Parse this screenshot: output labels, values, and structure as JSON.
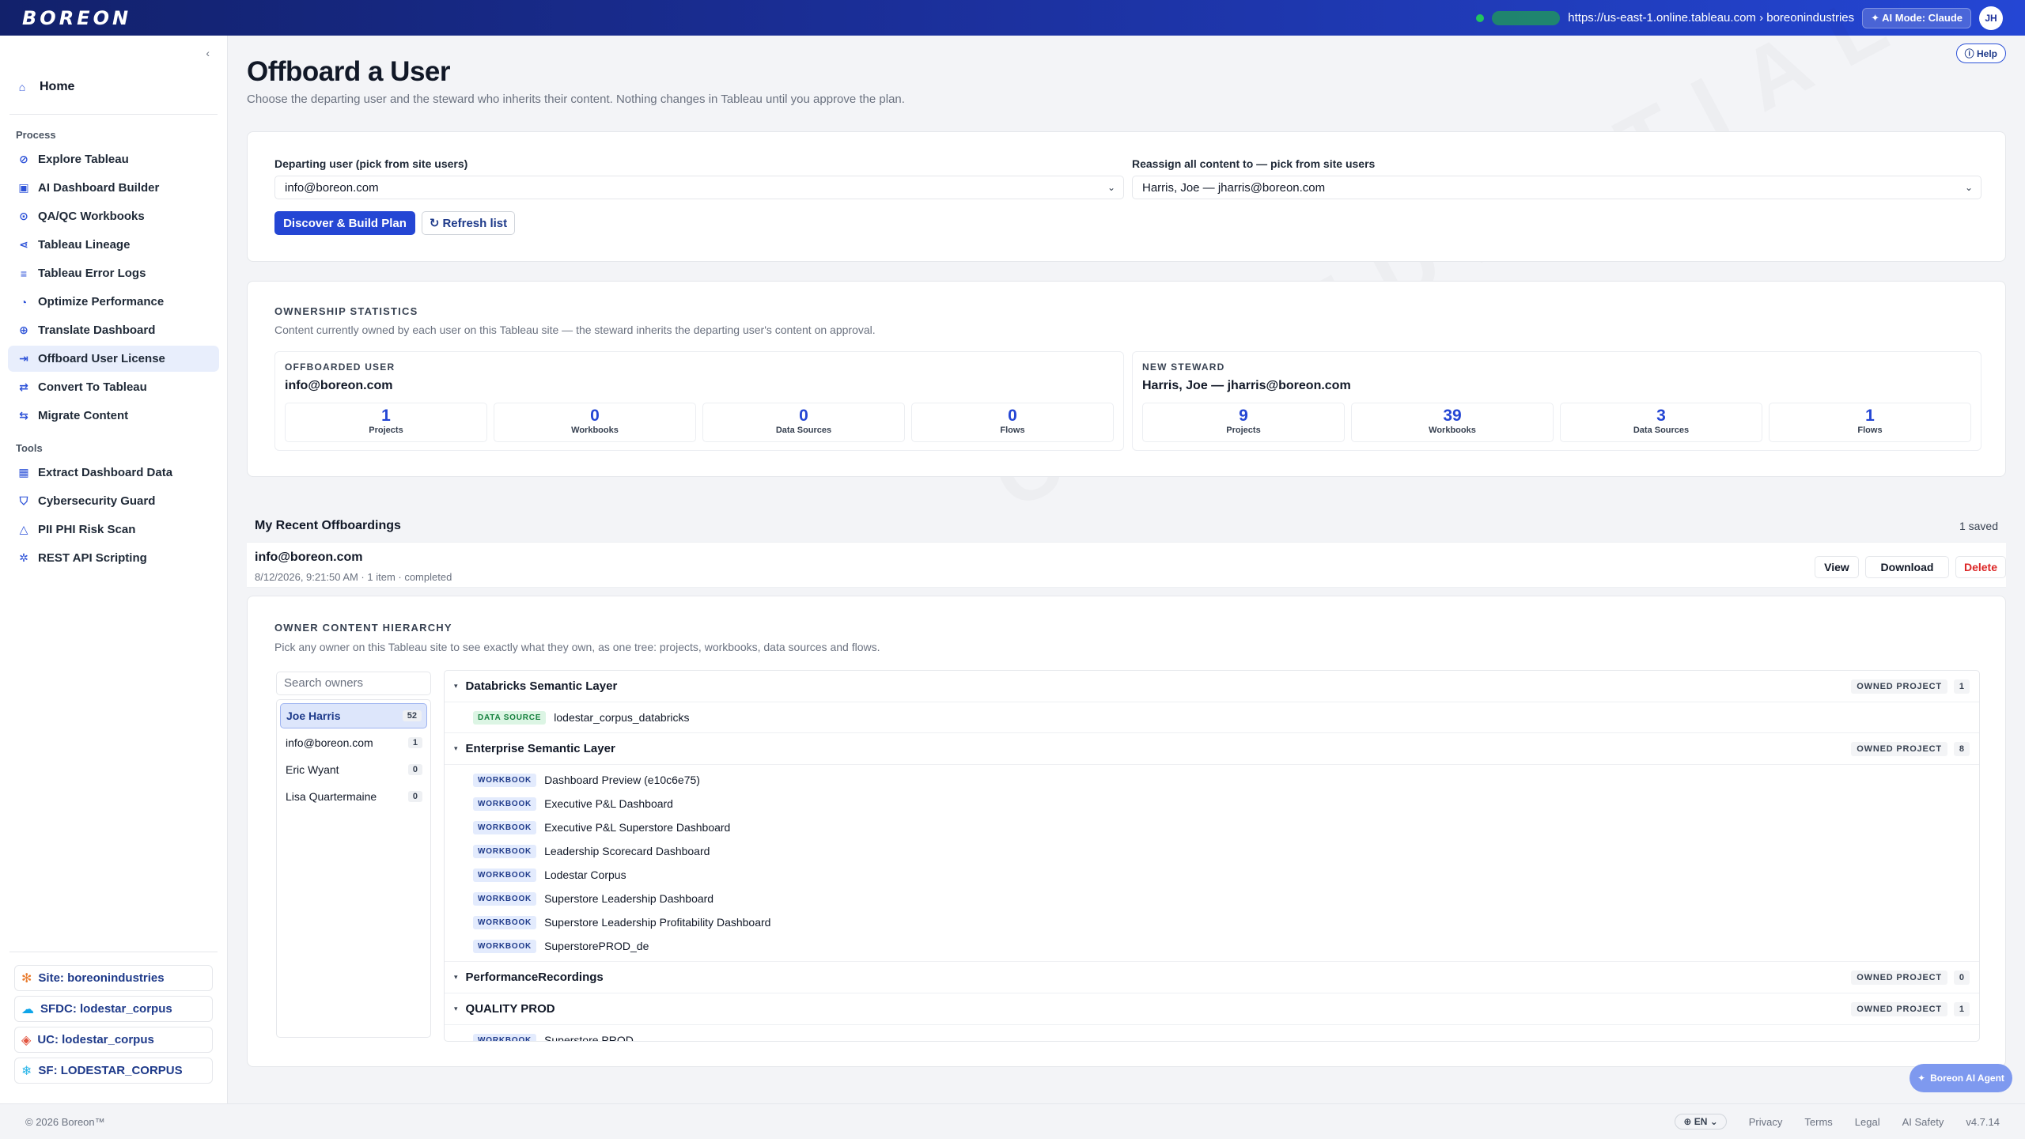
{
  "topbar": {
    "logo": "BOREON",
    "url": "https://us-east-1.online.tableau.com › boreonindustries",
    "ai_mode": "✦ AI Mode: Claude",
    "avatar": "JH"
  },
  "sidebar": {
    "home": "Home",
    "process_label": "Process",
    "process_items": [
      "Explore Tableau",
      "AI Dashboard Builder",
      "QA/QC Workbooks",
      "Tableau Lineage",
      "Tableau Error Logs",
      "Optimize Performance",
      "Translate Dashboard",
      "Offboard User License",
      "Convert To Tableau",
      "Migrate Content"
    ],
    "tools_label": "Tools",
    "tools_items": [
      "Extract Dashboard Data",
      "Cybersecurity Guard",
      "PII PHI Risk Scan",
      "REST API Scripting"
    ],
    "connections": [
      "Site: boreonindustries",
      "SFDC: lodestar_corpus",
      "UC: lodestar_corpus",
      "SF: LODESTAR_CORPUS"
    ]
  },
  "page": {
    "help": "Help",
    "title": "Offboard a User",
    "subtitle": "Choose the departing user and the steward who inherits their content. Nothing changes in Tableau until you approve the plan."
  },
  "form": {
    "departing_label": "Departing user (pick from site users)",
    "departing_value": "info@boreon.com",
    "reassign_label": "Reassign all content to — pick from site users",
    "reassign_value": "Harris, Joe — jharris@boreon.com",
    "discover_button": "Discover & Build Plan",
    "refresh_button": "Refresh list"
  },
  "ownership": {
    "title": "OWNERSHIP STATISTICS",
    "subtitle": "Content currently owned by each user on this Tableau site — the steward inherits the departing user's content on approval.",
    "offboarded": {
      "label": "OFFBOARDED USER",
      "user": "info@boreon.com",
      "stats": [
        {
          "value": "1",
          "label": "Projects"
        },
        {
          "value": "0",
          "label": "Workbooks"
        },
        {
          "value": "0",
          "label": "Data Sources"
        },
        {
          "value": "0",
          "label": "Flows"
        }
      ]
    },
    "steward": {
      "label": "NEW STEWARD",
      "user": "Harris, Joe — jharris@boreon.com",
      "stats": [
        {
          "value": "9",
          "label": "Projects"
        },
        {
          "value": "39",
          "label": "Workbooks"
        },
        {
          "value": "3",
          "label": "Data Sources"
        },
        {
          "value": "1",
          "label": "Flows"
        }
      ]
    }
  },
  "recent": {
    "title": "My Recent Offboardings",
    "count": "1 saved",
    "email": "info@boreon.com",
    "meta": "8/12/2026, 9:21:50 AM · 1 item · completed",
    "view": "View",
    "download": "Download",
    "delete": "Delete"
  },
  "hierarchy": {
    "title": "OWNER CONTENT HIERARCHY",
    "subtitle": "Pick any owner on this Tableau site to see exactly what they own, as one tree: projects, workbooks, data sources and flows.",
    "search_placeholder": "Search owners",
    "owners": [
      {
        "name": "Joe Harris",
        "count": "52"
      },
      {
        "name": "info@boreon.com",
        "count": "1"
      },
      {
        "name": "Eric Wyant",
        "count": "0"
      },
      {
        "name": "Lisa Quartermaine",
        "count": "0"
      }
    ],
    "owned_tag": "OWNED PROJECT",
    "workbook_tag": "WORKBOOK",
    "datasource_tag": "DATA SOURCE",
    "projects": [
      {
        "name": "Databricks Semantic Layer",
        "count": "1",
        "datasources": [
          "lodestar_corpus_databricks"
        ]
      },
      {
        "name": "Enterprise Semantic Layer",
        "count": "8",
        "workbooks": [
          "Dashboard Preview (e10c6e75)",
          "Executive P&L Dashboard",
          "Executive P&L Superstore Dashboard",
          "Leadership Scorecard Dashboard",
          "Lodestar Corpus",
          "Superstore Leadership Dashboard",
          "Superstore Leadership Profitability Dashboard",
          "SuperstorePROD_de"
        ]
      },
      {
        "name": "PerformanceRecordings",
        "count": "0"
      },
      {
        "name": "QUALITY PROD",
        "count": "1",
        "workbooks": [
          "Superstore PROD"
        ]
      }
    ]
  },
  "agent_button": "Boreon AI Agent",
  "footer": {
    "copyright": "© 2026   Boreon™",
    "lang": "EN",
    "links": [
      "Privacy",
      "Terms",
      "Legal",
      "AI Safety"
    ],
    "version": "v4.7.14"
  }
}
